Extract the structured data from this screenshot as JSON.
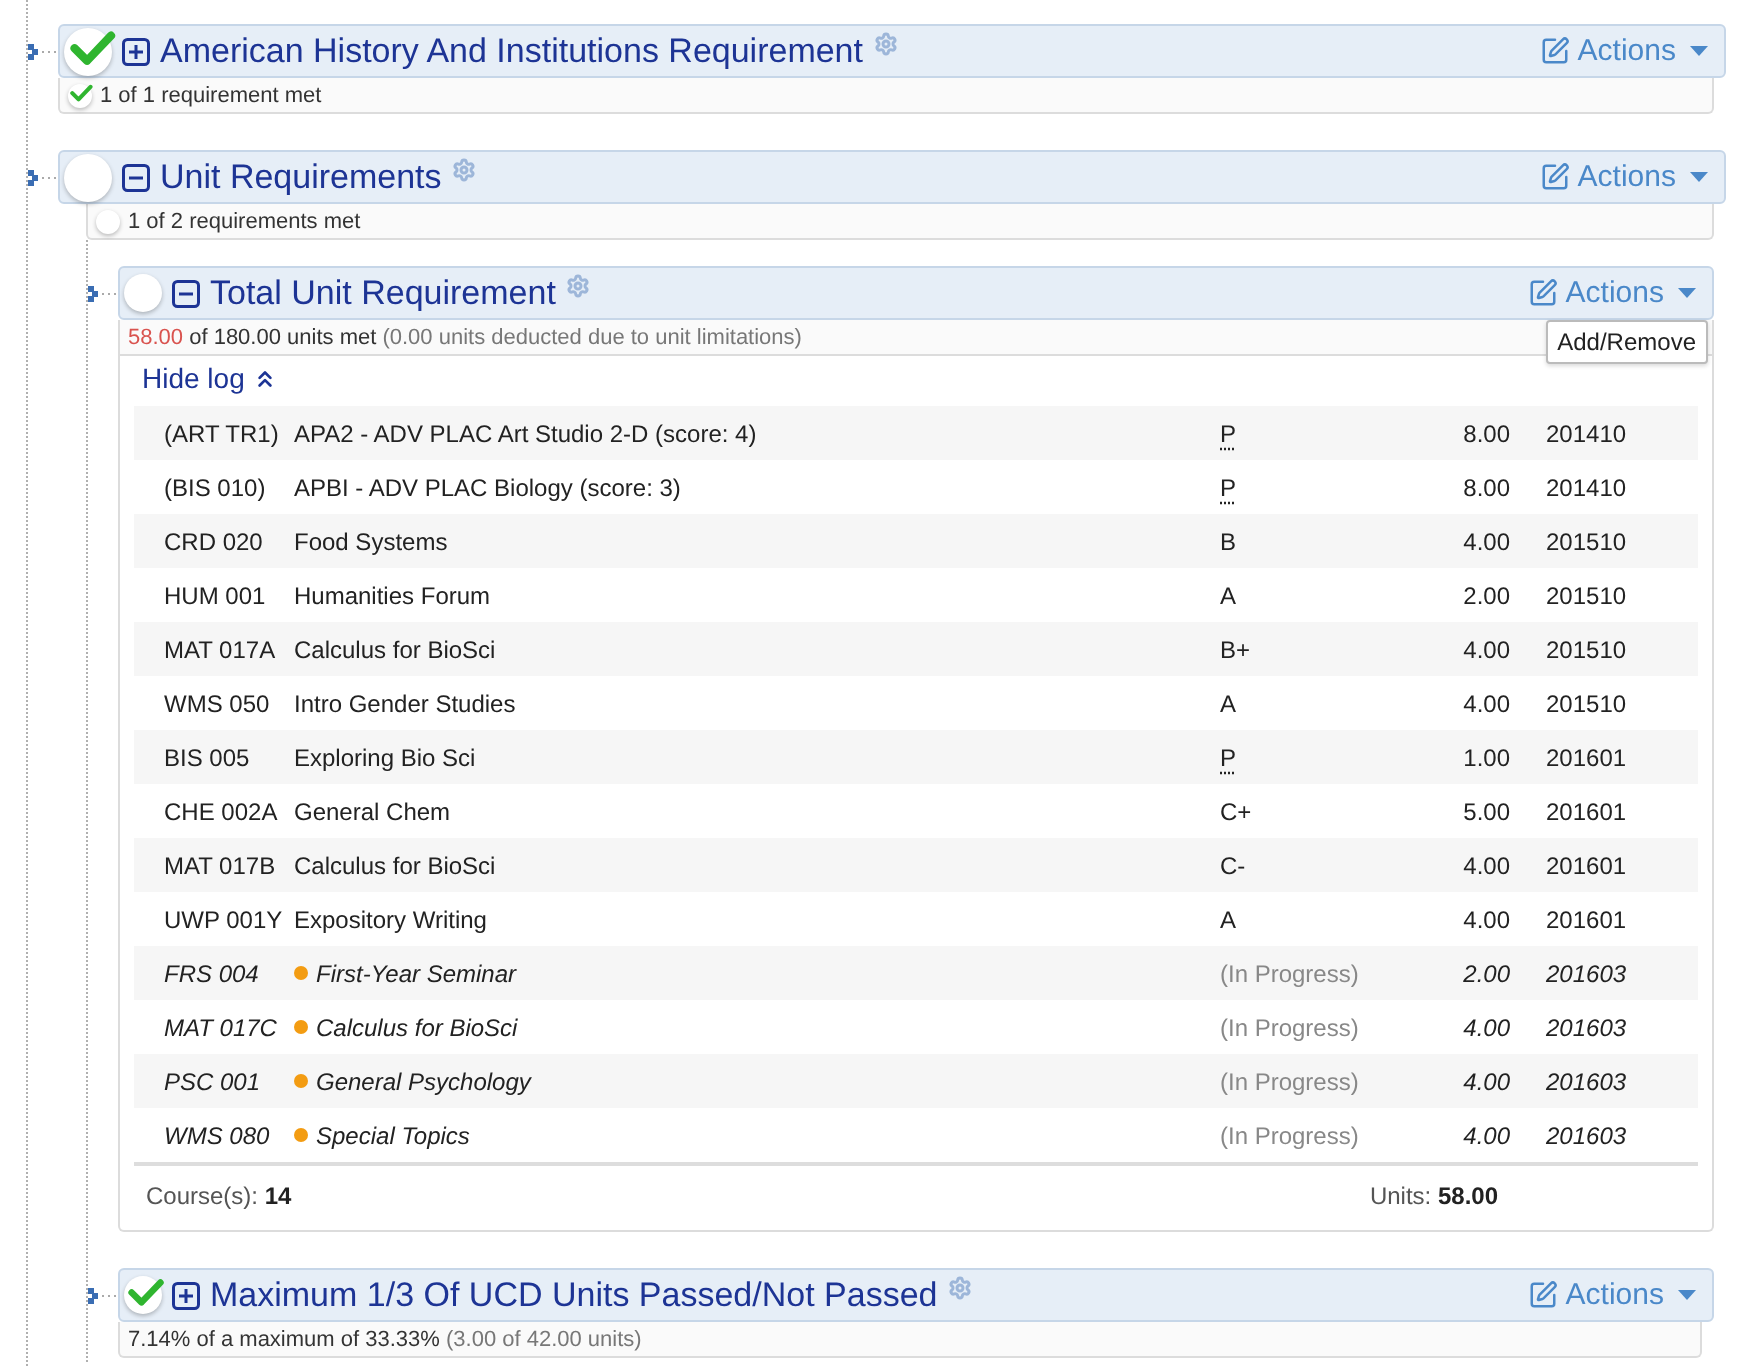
{
  "requirements": [
    {
      "title": "American History And Institutions Requirement",
      "met": true,
      "expanded": false,
      "actions": "Actions",
      "summary": [
        {
          "text": "1 of 1 requirement met",
          "kind": "main"
        }
      ]
    },
    {
      "title": "Unit Requirements",
      "met": false,
      "expanded": true,
      "actions": "Actions",
      "summary": [
        {
          "text": "1 of 2 requirements met",
          "kind": "main"
        }
      ],
      "children": [
        {
          "title": "Total Unit Requirement",
          "met": false,
          "expanded": true,
          "actions": "Actions",
          "tooltip": "Add/Remove",
          "summary": [
            {
              "text": "58.00",
              "kind": "alert"
            },
            {
              "text": "of 180.00 units met",
              "kind": "main"
            },
            {
              "text": "(0.00 units deducted due to unit limitations)",
              "kind": "note"
            }
          ],
          "log": {
            "toggle": "Hide log",
            "rows": [
              {
                "course": "(ART TR1)",
                "title": "APA2 - ADV PLAC Art Studio 2-D (score: 4)",
                "grade": "P",
                "abbr": true,
                "units": "8.00",
                "term": "201410",
                "in_progress": false
              },
              {
                "course": "(BIS 010)",
                "title": "APBI - ADV PLAC Biology (score: 3)",
                "grade": "P",
                "abbr": true,
                "units": "8.00",
                "term": "201410",
                "in_progress": false
              },
              {
                "course": "CRD 020",
                "title": "Food Systems",
                "grade": "B",
                "abbr": false,
                "units": "4.00",
                "term": "201510",
                "in_progress": false
              },
              {
                "course": "HUM 001",
                "title": "Humanities Forum",
                "grade": "A",
                "abbr": false,
                "units": "2.00",
                "term": "201510",
                "in_progress": false
              },
              {
                "course": "MAT 017A",
                "title": "Calculus for BioSci",
                "grade": "B+",
                "abbr": false,
                "units": "4.00",
                "term": "201510",
                "in_progress": false
              },
              {
                "course": "WMS 050",
                "title": "Intro Gender Studies",
                "grade": "A",
                "abbr": false,
                "units": "4.00",
                "term": "201510",
                "in_progress": false
              },
              {
                "course": "BIS 005",
                "title": "Exploring Bio Sci",
                "grade": "P",
                "abbr": true,
                "units": "1.00",
                "term": "201601",
                "in_progress": false
              },
              {
                "course": "CHE 002A",
                "title": "General Chem",
                "grade": "C+",
                "abbr": false,
                "units": "5.00",
                "term": "201601",
                "in_progress": false
              },
              {
                "course": "MAT 017B",
                "title": "Calculus for BioSci",
                "grade": "C-",
                "abbr": false,
                "units": "4.00",
                "term": "201601",
                "in_progress": false
              },
              {
                "course": "UWP 001Y",
                "title": "Expository Writing",
                "grade": "A",
                "abbr": false,
                "units": "4.00",
                "term": "201601",
                "in_progress": false
              },
              {
                "course": "FRS 004",
                "title": "First-Year Seminar",
                "grade": "(In Progress)",
                "abbr": false,
                "units": "2.00",
                "term": "201603",
                "in_progress": true
              },
              {
                "course": "MAT 017C",
                "title": "Calculus for BioSci",
                "grade": "(In Progress)",
                "abbr": false,
                "units": "4.00",
                "term": "201603",
                "in_progress": true
              },
              {
                "course": "PSC 001",
                "title": "General Psychology",
                "grade": "(In Progress)",
                "abbr": false,
                "units": "4.00",
                "term": "201603",
                "in_progress": true
              },
              {
                "course": "WMS 080",
                "title": "Special Topics",
                "grade": "(In Progress)",
                "abbr": false,
                "units": "4.00",
                "term": "201603",
                "in_progress": true
              }
            ],
            "footer": {
              "courses_label": "Course(s):",
              "courses": "14",
              "units_label": "Units:",
              "units": "58.00"
            }
          }
        },
        {
          "title": "Maximum 1/3 Of UCD Units Passed/Not Passed",
          "met": true,
          "expanded": false,
          "actions": "Actions",
          "summary": [
            {
              "text": "7.14% of a maximum of 33.33%",
              "kind": "main"
            },
            {
              "text": "(3.00 of 42.00 units)",
              "kind": "note"
            }
          ]
        }
      ]
    }
  ]
}
